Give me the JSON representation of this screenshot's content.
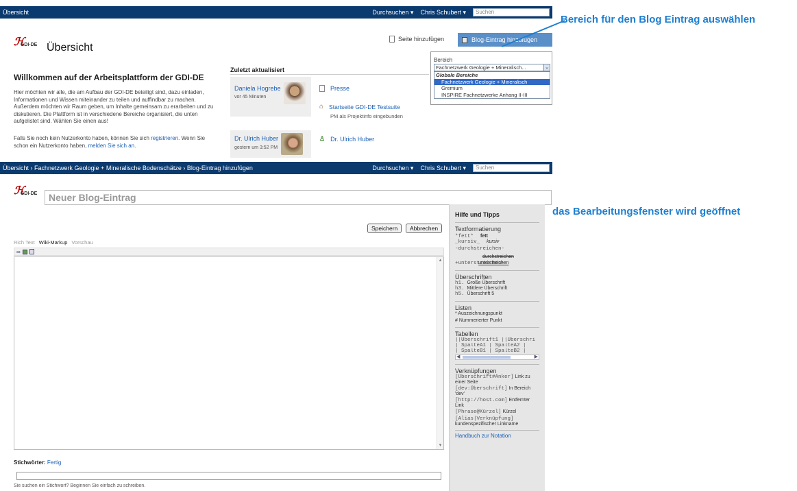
{
  "top1": {
    "left": "Übersicht",
    "browse": "Durchsuchen ▾",
    "user": "Chris Schubert ▾",
    "search_placeholder": "Suchen"
  },
  "logo": {
    "mark": "ℋ",
    "gdi": "GDI-DE"
  },
  "page1": {
    "title": "Übersicht",
    "add_page": "Seite hinzufügen",
    "add_blog": "Blog-Eintrag hinzufügen",
    "welcome_title": "Willkommen auf der Arbeitsplattform der GDI-DE",
    "welcome_text": "Hier möchten wir alle, die am Aufbau der GDI-DE beteiligt sind, dazu einladen, Informationen und Wissen miteinander zu teilen und auffindbar zu machen. Außerdem möchten wir Raum geben, um Inhalte gemeinsam zu erarbeiten und zu diskutieren. Die Plattform ist in verschiedene Bereiche organisiert, die unten aufgelistet sind. Wählen Sie einen aus!",
    "register_text_a": "Falls Sie noch kein Nutzerkonto haben, können Sie sich ",
    "register_link": "registrieren",
    "register_text_b": ". Wenn Sie schon ein Nutzerkonto haben, ",
    "login_link": "melden Sie sich an",
    "register_text_c": ".",
    "recent_title": "Zuletzt aktualisiert",
    "recent": [
      {
        "user": "Daniela Hogrebe",
        "time": "vor 45 Minuten",
        "item1": "Presse",
        "item2": "Startseite GDI-DE Testsuite",
        "item2_sub": "PM als Projektinfo eingebunden"
      },
      {
        "user": "Dr. Ulrich Huber",
        "time": "gestern um 3:52 PM",
        "item1": "Dr. Ulrich Huber"
      }
    ],
    "dropdown": {
      "label": "Bereich",
      "selected": "Fachnetzwerk Geologie + Mineralisch...",
      "group": "Globale Bereiche",
      "options": [
        "Fachnetzwerk Geologie + Mineralisch",
        "Gremium",
        "INSPIRE Fachnetzwerke Anhang II-III"
      ]
    }
  },
  "top2": {
    "breadcrumb": "Übersicht  ›  Fachnetzwerk Geologie + Mineralische Bodenschätze  ›  Blog-Eintrag hinzufügen",
    "browse": "Durchsuchen ▾",
    "user": "Chris Schubert ▾",
    "search_placeholder": "Suchen"
  },
  "editor": {
    "title_placeholder": "Neuer Blog-Eintrag",
    "save": "Speichern",
    "cancel": "Abbrechen",
    "tabs": [
      "Rich Text",
      "Wiki-Markup",
      "Vorschau"
    ],
    "keywords_label": "Stichwörter:",
    "keywords_link": "Fertig",
    "keywords_hint": "Sie suchen ein Stichwort? Beginnen Sie einfach zu schreiben."
  },
  "help": {
    "title": "Hilfe und Tipps",
    "format_title": "Textformatierung",
    "format": [
      [
        "*fett*",
        "fett"
      ],
      [
        "_kursiv_",
        "kursiv"
      ],
      [
        "-durchstreichen-",
        "durchstreichen"
      ],
      [
        "+unterstreichen+",
        "unterstreichen"
      ]
    ],
    "headings_title": "Überschriften",
    "headings": [
      [
        "h1.",
        "Große Überschrift"
      ],
      [
        "h3.",
        "Mittlere Überschrift"
      ],
      [
        "h5.",
        "Überschrift 5"
      ]
    ],
    "lists_title": "Listen",
    "lists": [
      "* Auszeichnungspunkt",
      "# Nummerierter Punkt"
    ],
    "tables_title": "Tabellen",
    "tables": [
      "||Überschrift1 ||Überschri",
      "| SpalteA1 | SpalteA2 |",
      "| SpalteB1 | SpalteB2 |"
    ],
    "links_title": "Verknüpfungen",
    "links": [
      [
        "[Überschrift#Anker]",
        "Link zu einer Seite"
      ],
      [
        "[dev:Überschrift]",
        "In Bereich 'dev'"
      ],
      [
        "[http://host.com]",
        "Entfernter Link"
      ],
      [
        "[Phrase@Kürzel]",
        "Kürzel"
      ],
      [
        "[Alias|Verknüpfung]",
        "kundenspezifischer Linkname"
      ]
    ],
    "manual": "Handbuch zur Notation"
  },
  "annotations": {
    "a1": "Bereich für den Blog Eintrag auswählen",
    "a2": "das Bearbeitungsfenster wird geöffnet"
  }
}
